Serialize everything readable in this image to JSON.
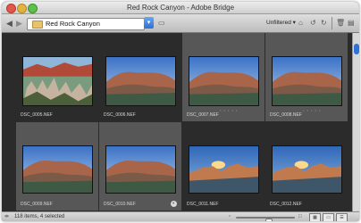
{
  "window": {
    "title": "Red Rock Canyon - Adobe Bridge"
  },
  "toolbar": {
    "path_label": "Red Rock Canyon",
    "filter_label": "Unfiltered",
    "icons": [
      "back-arrow-icon",
      "forward-arrow-icon",
      "folder-icon",
      "dropdown-icon",
      "camera-icon",
      "rotate-left-icon",
      "rotate-right-icon",
      "trash-icon",
      "new-folder-icon"
    ]
  },
  "thumbnails": [
    {
      "name": "DSC_0005.NEF",
      "selected": false,
      "scene": "vegetation",
      "stars": ""
    },
    {
      "name": "DSC_0006.NEF",
      "selected": false,
      "scene": "canyon",
      "stars": ""
    },
    {
      "name": "DSC_0007.NEF",
      "selected": true,
      "scene": "canyon",
      "stars": "• • • • •"
    },
    {
      "name": "DSC_0008.NEF",
      "selected": true,
      "scene": "canyon",
      "stars": "• • • • •"
    },
    {
      "name": "DSC_0009.NEF",
      "selected": true,
      "scene": "canyon",
      "stars": ""
    },
    {
      "name": "DSC_0010.NEF",
      "selected": true,
      "scene": "canyon",
      "stars": ""
    },
    {
      "name": "DSC_0011.NEF",
      "selected": false,
      "scene": "sunset",
      "stars": ""
    },
    {
      "name": "DSC_0012.NEF",
      "selected": false,
      "scene": "sunset",
      "stars": ""
    }
  ],
  "status": {
    "text": "118 items, 4 selected",
    "thumbnail_size": 0.55
  },
  "colors": {
    "content_bg": "#2b2b2b",
    "selection_bg": "#575757",
    "accent": "#2f72d8"
  }
}
